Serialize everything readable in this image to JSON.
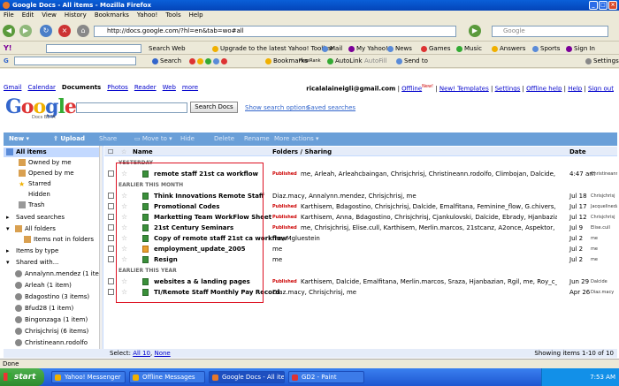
{
  "window": {
    "title": "Google Docs - All items - Mozilla Firefox"
  },
  "menu": [
    "File",
    "Edit",
    "View",
    "History",
    "Bookmarks",
    "Yahoo!",
    "Tools",
    "Help"
  ],
  "nav": {
    "url": "http://docs.google.com/?hl=en&tab=wo#all",
    "search_placeholder": "Google"
  },
  "yahoo_toolbar": {
    "search_web": "Search Web",
    "upgrade": "Upgrade to the latest Yahoo! Toolbar",
    "mail": "Mail",
    "my_yahoo": "My Yahoo!",
    "news": "News",
    "games": "Games",
    "music": "Music",
    "answers": "Answers",
    "sports": "Sports",
    "sign_in": "Sign In"
  },
  "google_toolbar": {
    "search": "Search",
    "bookmarks": "Bookmarks",
    "pagerank": "PageRank",
    "autolink": "AutoLink",
    "autofill": "AutoFill",
    "sendto": "Send to",
    "settings": "Settings"
  },
  "gbar": {
    "links": [
      "Gmail",
      "Calendar",
      "Documents",
      "Photos",
      "Reader",
      "Web",
      "more"
    ],
    "current": "Documents",
    "email": "ricalalaineigli@gmail.com",
    "offline": "Offline",
    "new_badge": "New!",
    "new_templates": "New! Templates",
    "settings": "Settings",
    "offline_help": "Offline help",
    "help": "Help",
    "sign_out": "Sign out"
  },
  "docs_header": {
    "logo": "Google",
    "logo_sub": "Docs BETA",
    "search_button": "Search Docs",
    "show_search_options": "Show search options",
    "saved_searches": "Saved searches"
  },
  "actions": {
    "new": "New",
    "upload": "Upload",
    "share": "Share",
    "move_to": "Move to",
    "hide": "Hide",
    "delete": "Delete",
    "rename": "Rename",
    "more_actions": "More actions"
  },
  "sidebar": {
    "items": [
      {
        "label": "All items",
        "selected": true
      },
      {
        "label": "Owned by me"
      },
      {
        "label": "Opened by me"
      },
      {
        "label": "Starred"
      },
      {
        "label": "Hidden"
      },
      {
        "label": "Trash"
      },
      {
        "label": "Saved searches"
      },
      {
        "label": "All folders"
      },
      {
        "label": "Items not in folders"
      },
      {
        "label": "Items by type"
      },
      {
        "label": "Shared with..."
      },
      {
        "label": "Annalynn.mendez (1 item)"
      },
      {
        "label": "Arleah (1 item)"
      },
      {
        "label": "Bdagostino (3 items)"
      },
      {
        "label": "Bfud28 (1 item)"
      },
      {
        "label": "Bingonzaga (1 item)"
      },
      {
        "label": "Chrisjchrisj (6 items)"
      },
      {
        "label": "Christineann.rodolfo"
      }
    ]
  },
  "list": {
    "headers": {
      "name": "Name",
      "folders": "Folders / Sharing",
      "date": "Date"
    },
    "sections": {
      "yesterday": "YESTERDAY",
      "earlier_month": "EARLIER THIS MONTH",
      "earlier_year": "EARLIER THIS YEAR"
    },
    "published_label": "Published",
    "rows": [
      {
        "title": "remote staff 21st ca workflow",
        "published": true,
        "sharing": "me, Arleah, Arleahcbaingan, Chrisjchrisj, Christineann.rodolfo, Climbojan, Dalcide, Dne",
        "date": "4:47 am",
        "who": "Christineann"
      },
      {
        "title": "Think Innovations Remote Staff",
        "published": false,
        "sharing": "Diaz.macy, Annalynn.mendez, Chrisjchrisj, me",
        "date": "Jul 18",
        "who": "Chrisjchrisj"
      },
      {
        "title": "Promotional Codes",
        "published": true,
        "sharing": "Karthisem, Bdagostino, Chrisjchrisj, Dalcide, Emalfitana, Feminine_flow, G.chivers, Hjanbazian, Ja",
        "date": "Jul 17",
        "who": "Jacquelinedavis"
      },
      {
        "title": "Marketting Team WorkFlow Sheet",
        "published": true,
        "sharing": "Karthisem, Anna, Bdagostino, Chrisjchrisj, Cjankulovski, Dalcide, Ebrady, Hjanbazian, Jalberto, Kal",
        "date": "Jul 12",
        "who": "Chrisjchrisj"
      },
      {
        "title": "21st Century Seminars",
        "published": true,
        "sharing": "me, Chrisjchrisj, Elise.cull, Karthisem, Merlin.marcos, 21stcanz, A2once, Aspektor, Bdagostino, Bfud28, Bing",
        "date": "Jul 9",
        "who": "Elise.cull"
      },
      {
        "title": "Copy of remote staff 21st ca workflow",
        "published": false,
        "sharing": "me, Mgluestein",
        "date": "Jul 2",
        "who": "me"
      },
      {
        "title": "employment_update_2005",
        "published": false,
        "sharing": "me",
        "date": "Jul 2",
        "who": "me",
        "pres": true
      },
      {
        "title": "Resign",
        "published": false,
        "sharing": "me",
        "date": "Jul 2",
        "who": "me"
      },
      {
        "title": "websites a & landing pages",
        "published": true,
        "sharing": "Karthisem, Dalcide, Emalfitana, Merlin.marcos, Sraza, Hjanbazian, Rgil, me, Roy_c_pepito",
        "date": "Jun 29",
        "who": "Dalcide"
      },
      {
        "title": "TI/Remote Staff Monthly Pay Record",
        "published": false,
        "sharing": "Diaz.macy, Chrisjchrisj, me",
        "date": "Apr 26",
        "who": "Diaz.macy"
      }
    ]
  },
  "footer": {
    "select": "Select:",
    "all": "All 10",
    "none": "None",
    "showing": "Showing items 1-10 of 10"
  },
  "status": "Done",
  "taskbar": {
    "start": "start",
    "tasks": [
      "Yahoo! Messenger",
      "Offline Messages",
      "Google Docs - All item...",
      "GD2 - Paint"
    ],
    "clock": "7:53 AM"
  },
  "colors": {
    "titlebar": "#0a5fd8",
    "toolbar": "#6a9fd8",
    "selected": "#c3d9ff",
    "highlight_box": "#dd1122",
    "published": "#cc0000"
  }
}
